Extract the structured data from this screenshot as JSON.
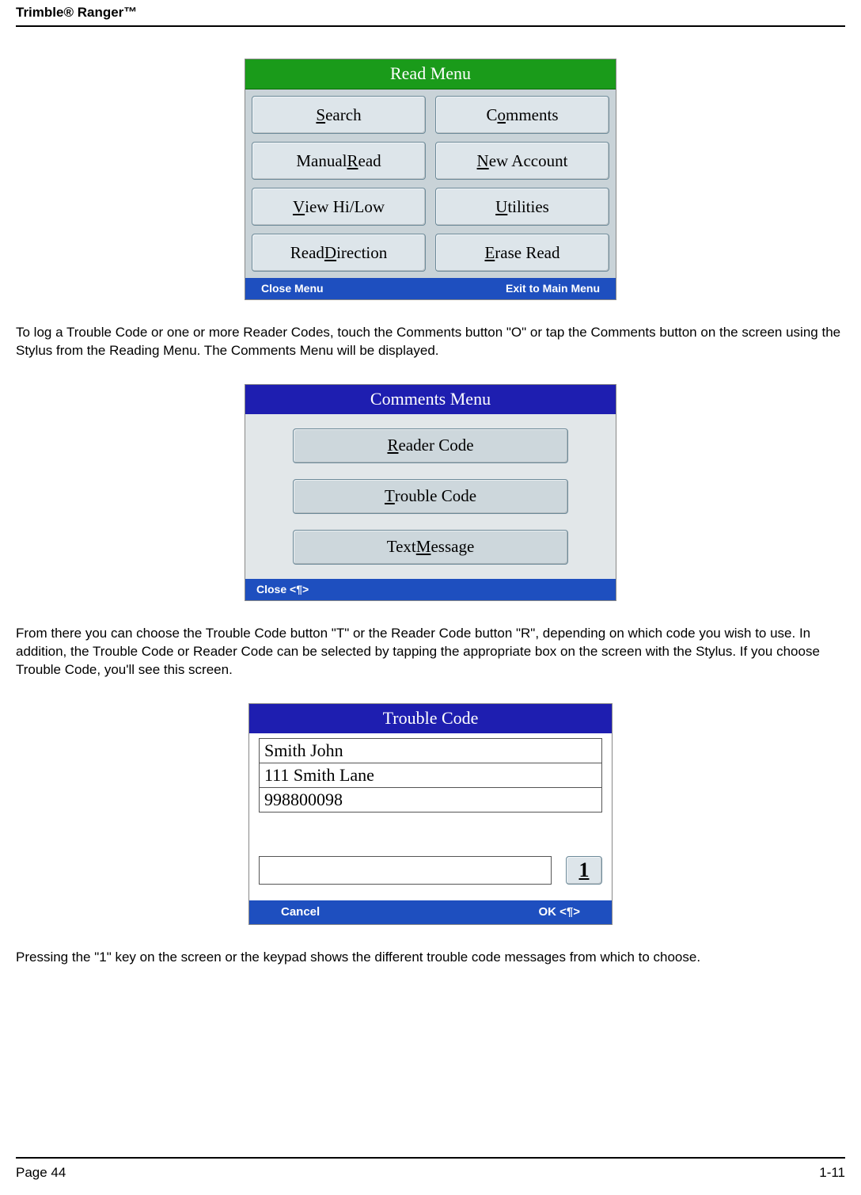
{
  "header": "Trimble® Ranger™",
  "para1": "To log a Trouble Code or one or more Reader Codes, touch the Comments button \"O\" or tap the Comments button on the screen using the Stylus from the Reading Menu.  The Comments Menu will be displayed.",
  "para2": "From there you can choose the Trouble Code button \"T\" or the Reader Code button \"R\", depending on which code you wish to use. In addition, the Trouble Code or Reader Code can be selected by tapping the appropriate box on the screen with the Stylus.  If you choose Trouble Code, you'll see this screen.",
  "para3": "Pressing the \"1\" key on the screen or the keypad shows the different trouble code messages from which to choose.",
  "footer_left": "Page 44",
  "footer_right": "1-11",
  "read_menu": {
    "title": "Read Menu",
    "buttons": {
      "search_pre": "",
      "search_u": "S",
      "search_post": "earch",
      "comments_pre": "C",
      "comments_u": "o",
      "comments_post": "mments",
      "manual_pre": "Manual ",
      "manual_u": "R",
      "manual_post": "ead",
      "newacct_pre": "",
      "newacct_u": "N",
      "newacct_post": "ew Account",
      "view_pre": "",
      "view_u": "V",
      "view_post": "iew Hi/Low",
      "util_pre": "",
      "util_u": "U",
      "util_post": "tilities",
      "dir_pre": "Read ",
      "dir_u": "D",
      "dir_post": "irection",
      "erase_pre": "",
      "erase_u": "E",
      "erase_post": "rase Read"
    },
    "footer_left": "Close Menu",
    "footer_right": "Exit to Main Menu"
  },
  "comments_menu": {
    "title": "Comments Menu",
    "reader_pre": "",
    "reader_u": "R",
    "reader_post": "eader Code",
    "trouble_pre": "",
    "trouble_u": "T",
    "trouble_post": "rouble Code",
    "text_pre": "Text ",
    "text_u": "M",
    "text_post": "essage",
    "footer": "Close <¶>"
  },
  "trouble_code": {
    "title": "Trouble Code",
    "name": "Smith John",
    "addr": "111 Smith Lane",
    "acct": "998800098",
    "one_u": "1",
    "footer_left": "Cancel",
    "footer_right": "OK <¶>"
  }
}
